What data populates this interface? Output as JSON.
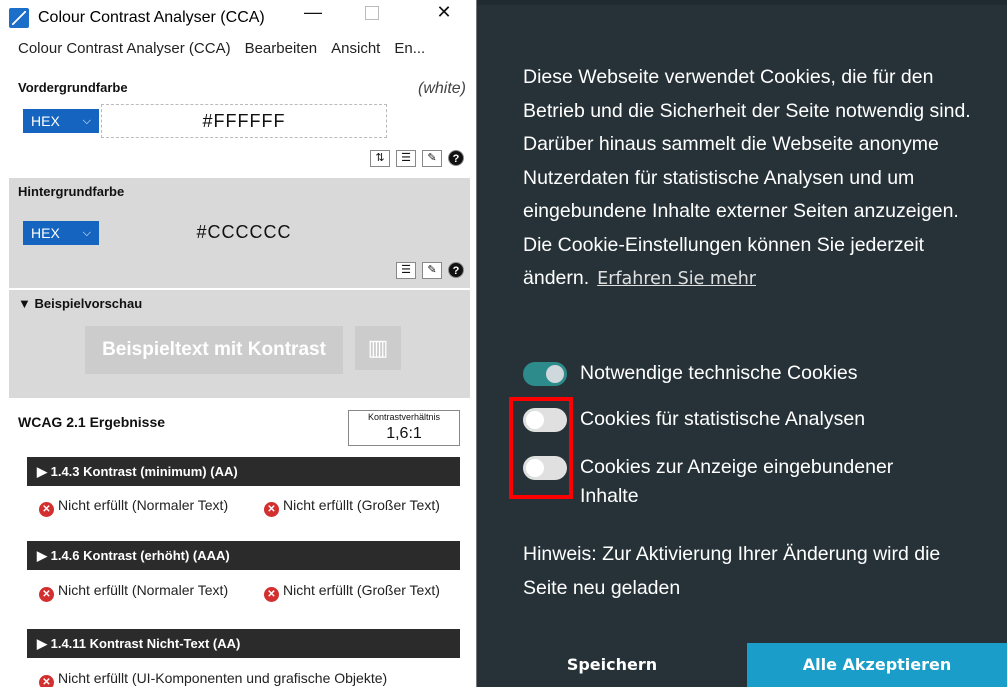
{
  "cca": {
    "window_title": "Colour Contrast Analyser (CCA)",
    "menu": [
      "Colour Contrast Analyser (CCA)",
      "Bearbeiten",
      "Ansicht",
      "En..."
    ],
    "foreground": {
      "label": "Vordergrundfarbe",
      "color_name": "(white)",
      "format": "HEX",
      "value": "#FFFFFF"
    },
    "background": {
      "label": "Hintergrundfarbe",
      "format": "HEX",
      "value": "#CCCCCC"
    },
    "preview": {
      "label": "▼ Beispielvorschau",
      "sample_text": "Beispieltext mit Kontrast"
    },
    "results": {
      "title": "WCAG 2.1 Ergebnisse",
      "ratio_label": "Kontrastverhältnis",
      "ratio_value": "1,6:1",
      "criteria": [
        {
          "title": "▶ 1.4.3 Kontrast (minimum) (AA)",
          "normal_text": "Nicht erfüllt (Normaler Text)",
          "large_text": "Nicht erfüllt (Großer Text)"
        },
        {
          "title": "▶ 1.4.6 Kontrast (erhöht) (AAA)",
          "normal_text": "Nicht erfüllt (Normaler Text)",
          "large_text": "Nicht erfüllt (Großer Text)"
        },
        {
          "title": "▶ 1.4.11 Kontrast Nicht-Text (AA)",
          "ui_text": "Nicht erfüllt (UI-Komponenten und grafische Objekte)"
        }
      ]
    },
    "colors": {
      "hex_select": "#1565c0",
      "fail": "#d32f2f",
      "section_gray": "#d9d9d9"
    }
  },
  "cookie": {
    "description": "Diese Webseite verwendet Cookies, die für den Betrieb und die Sicherheit der Seite notwendig sind. Darüber hinaus sammelt die Webseite anonyme Nutzerdaten für statistische Analysen und um eingebundene Inhalte externer Seiten anzuzeigen. Die Cookie-Einstellungen können Sie jederzeit ändern.",
    "learn_more": "Erfahren Sie mehr",
    "toggles": [
      {
        "label": "Notwendige technische Cookies",
        "state": "on"
      },
      {
        "label": "Cookies für statistische Analysen",
        "state": "off"
      },
      {
        "label": "Cookies zur Anzeige eingebundener Inhalte",
        "state": "off"
      }
    ],
    "hint": "Hinweis: Zur Aktivierung Ihrer Änderung wird die Seite neu geladen",
    "save_label": "Speichern",
    "accept_all_label": "Alle Akzeptieren",
    "colors": {
      "panel_bg": "#263238",
      "toggle_on": "#2e8b8b",
      "accept_bg": "#1a9dc9",
      "highlight": "#ff0000"
    }
  }
}
